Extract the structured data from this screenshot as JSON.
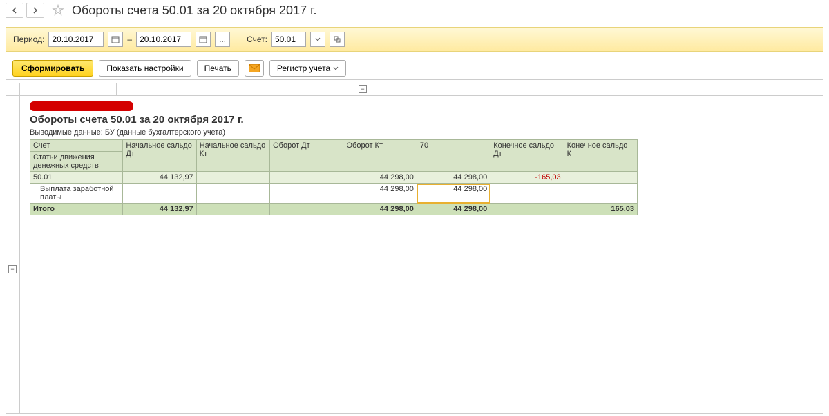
{
  "title": "Обороты счета 50.01 за 20 октября 2017 г.",
  "period": {
    "label": "Период:",
    "from": "20.10.2017",
    "to": "20.10.2017",
    "dash": "–",
    "account_label": "Счет:",
    "account": "50.01"
  },
  "toolbar": {
    "generate": "Сформировать",
    "show_settings": "Показать настройки",
    "print": "Печать",
    "register": "Регистр учета"
  },
  "report": {
    "title": "Обороты счета 50.01 за 20 октября 2017 г.",
    "sub": "Выводимые данные:  БУ (данные бухгалтерского учета)",
    "headers": {
      "h1a": "Счет",
      "h1b": "Статьи движения денежных средств",
      "h2": "Начальное сальдо Дт",
      "h3": "Начальное сальдо Кт",
      "h4": "Оборот Дт",
      "h5": "Оборот Кт",
      "h6": "70",
      "h7": "Конечное сальдо Дт",
      "h8": "Конечное сальдо Кт"
    },
    "row1": {
      "c1": "50.01",
      "c2": "44 132,97",
      "c3": "",
      "c4": "",
      "c5": "44 298,00",
      "c6": "44 298,00",
      "c7": "-165,03",
      "c8": ""
    },
    "row2": {
      "c1": "Выплата заработной платы",
      "c2": "",
      "c3": "",
      "c4": "",
      "c5": "44 298,00",
      "c6": "44 298,00",
      "c7": "",
      "c8": ""
    },
    "total": {
      "c1": "Итого",
      "c2": "44 132,97",
      "c3": "",
      "c4": "",
      "c5": "44 298,00",
      "c6": "44 298,00",
      "c7": "",
      "c8": "165,03"
    }
  }
}
